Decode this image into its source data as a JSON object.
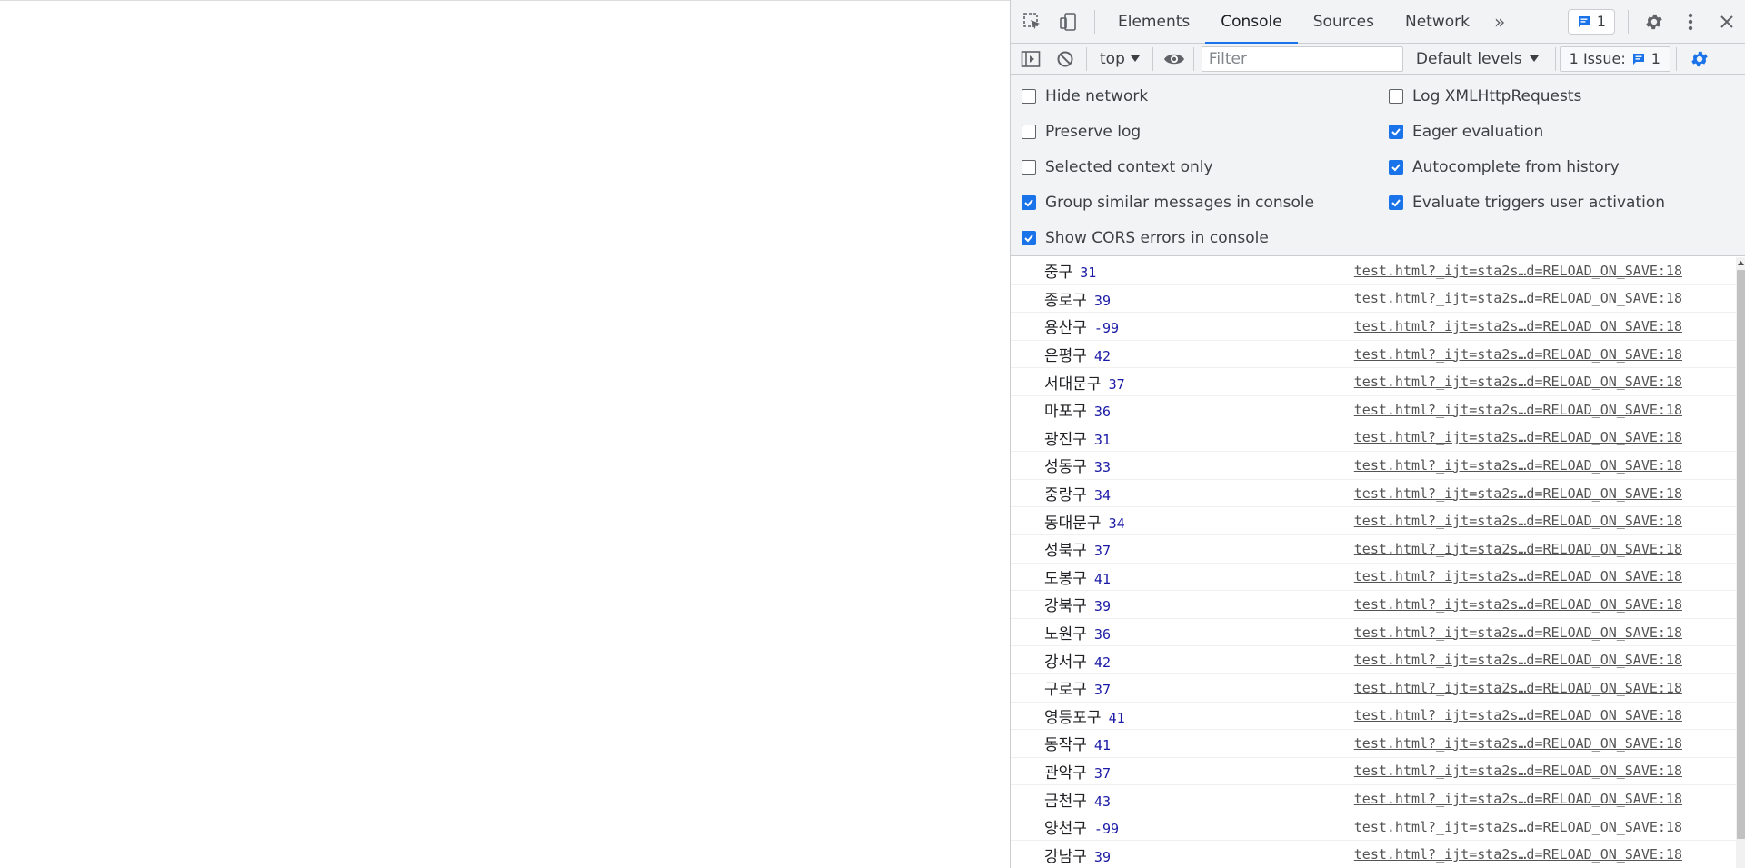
{
  "devtools": {
    "tabs": [
      "Elements",
      "Console",
      "Sources",
      "Network"
    ],
    "active_tab": "Console",
    "more_tabs_glyph": "»",
    "issues_badge_count": "1",
    "accent_color": "#1a73e8"
  },
  "console_toolbar": {
    "context": "top",
    "filter_placeholder": "Filter",
    "levels_label": "Default levels",
    "issues_label": "1 Issue:",
    "issues_count": "1"
  },
  "settings": {
    "left": [
      {
        "label": "Hide network",
        "checked": false
      },
      {
        "label": "Preserve log",
        "checked": false
      },
      {
        "label": "Selected context only",
        "checked": false
      },
      {
        "label": "Group similar messages in console",
        "checked": true
      },
      {
        "label": "Show CORS errors in console",
        "checked": true
      }
    ],
    "right": [
      {
        "label": "Log XMLHttpRequests",
        "checked": false
      },
      {
        "label": "Eager evaluation",
        "checked": true
      },
      {
        "label": "Autocomplete from history",
        "checked": true
      },
      {
        "label": "Evaluate triggers user activation",
        "checked": true
      }
    ]
  },
  "messages": [
    {
      "text": "중구",
      "value": "31",
      "source": "test.html?_ijt=sta2s…d=RELOAD_ON_SAVE:18"
    },
    {
      "text": "종로구",
      "value": "39",
      "source": "test.html?_ijt=sta2s…d=RELOAD_ON_SAVE:18"
    },
    {
      "text": "용산구",
      "value": "-99",
      "source": "test.html?_ijt=sta2s…d=RELOAD_ON_SAVE:18"
    },
    {
      "text": "은평구",
      "value": "42",
      "source": "test.html?_ijt=sta2s…d=RELOAD_ON_SAVE:18"
    },
    {
      "text": "서대문구",
      "value": "37",
      "source": "test.html?_ijt=sta2s…d=RELOAD_ON_SAVE:18"
    },
    {
      "text": "마포구",
      "value": "36",
      "source": "test.html?_ijt=sta2s…d=RELOAD_ON_SAVE:18"
    },
    {
      "text": "광진구",
      "value": "31",
      "source": "test.html?_ijt=sta2s…d=RELOAD_ON_SAVE:18"
    },
    {
      "text": "성동구",
      "value": "33",
      "source": "test.html?_ijt=sta2s…d=RELOAD_ON_SAVE:18"
    },
    {
      "text": "중랑구",
      "value": "34",
      "source": "test.html?_ijt=sta2s…d=RELOAD_ON_SAVE:18"
    },
    {
      "text": "동대문구",
      "value": "34",
      "source": "test.html?_ijt=sta2s…d=RELOAD_ON_SAVE:18"
    },
    {
      "text": "성북구",
      "value": "37",
      "source": "test.html?_ijt=sta2s…d=RELOAD_ON_SAVE:18"
    },
    {
      "text": "도봉구",
      "value": "41",
      "source": "test.html?_ijt=sta2s…d=RELOAD_ON_SAVE:18"
    },
    {
      "text": "강북구",
      "value": "39",
      "source": "test.html?_ijt=sta2s…d=RELOAD_ON_SAVE:18"
    },
    {
      "text": "노원구",
      "value": "36",
      "source": "test.html?_ijt=sta2s…d=RELOAD_ON_SAVE:18"
    },
    {
      "text": "강서구",
      "value": "42",
      "source": "test.html?_ijt=sta2s…d=RELOAD_ON_SAVE:18"
    },
    {
      "text": "구로구",
      "value": "37",
      "source": "test.html?_ijt=sta2s…d=RELOAD_ON_SAVE:18"
    },
    {
      "text": "영등포구",
      "value": "41",
      "source": "test.html?_ijt=sta2s…d=RELOAD_ON_SAVE:18"
    },
    {
      "text": "동작구",
      "value": "41",
      "source": "test.html?_ijt=sta2s…d=RELOAD_ON_SAVE:18"
    },
    {
      "text": "관악구",
      "value": "37",
      "source": "test.html?_ijt=sta2s…d=RELOAD_ON_SAVE:18"
    },
    {
      "text": "금천구",
      "value": "43",
      "source": "test.html?_ijt=sta2s…d=RELOAD_ON_SAVE:18"
    },
    {
      "text": "양천구",
      "value": "-99",
      "source": "test.html?_ijt=sta2s…d=RELOAD_ON_SAVE:18"
    },
    {
      "text": "강남구",
      "value": "39",
      "source": "test.html?_ijt=sta2s…d=RELOAD_ON_SAVE:18"
    }
  ]
}
